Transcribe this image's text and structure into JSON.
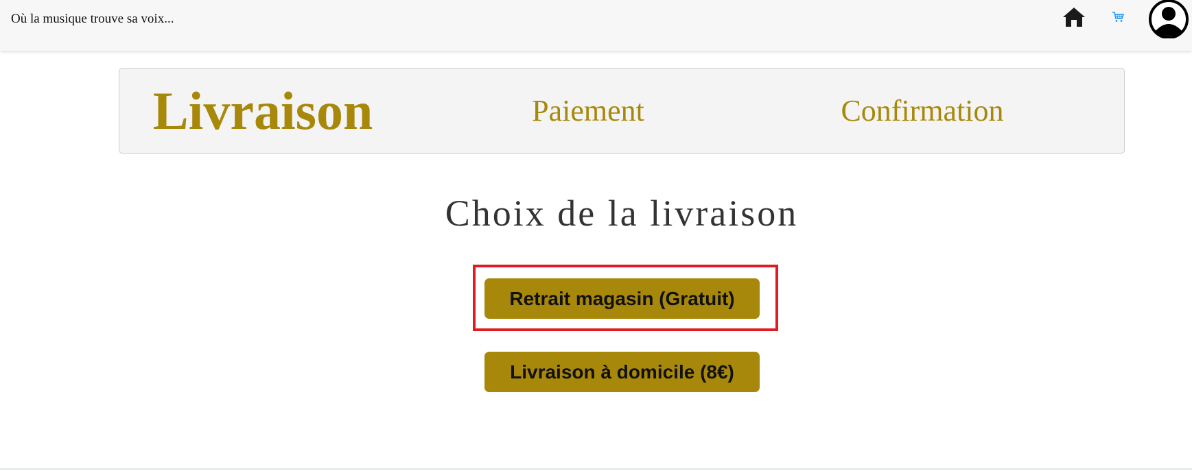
{
  "header": {
    "tagline": "Où la musique trouve sa voix...",
    "icons": [
      "home-icon",
      "cart-icon",
      "user-avatar-icon"
    ],
    "cart_color": "#2196f3"
  },
  "steps": {
    "items": [
      {
        "label": "Livraison",
        "active": true
      },
      {
        "label": "Paiement",
        "active": false
      },
      {
        "label": "Confirmation",
        "active": false
      }
    ],
    "color": "#a8880a"
  },
  "main": {
    "heading": "Choix de la livraison",
    "options": [
      {
        "label": "Retrait magasin (Gratuit)",
        "highlighted": true
      },
      {
        "label": "Livraison à domicile (8€)",
        "highlighted": false
      }
    ],
    "button_color": "#a8880a",
    "highlight_color": "#e01b24"
  }
}
